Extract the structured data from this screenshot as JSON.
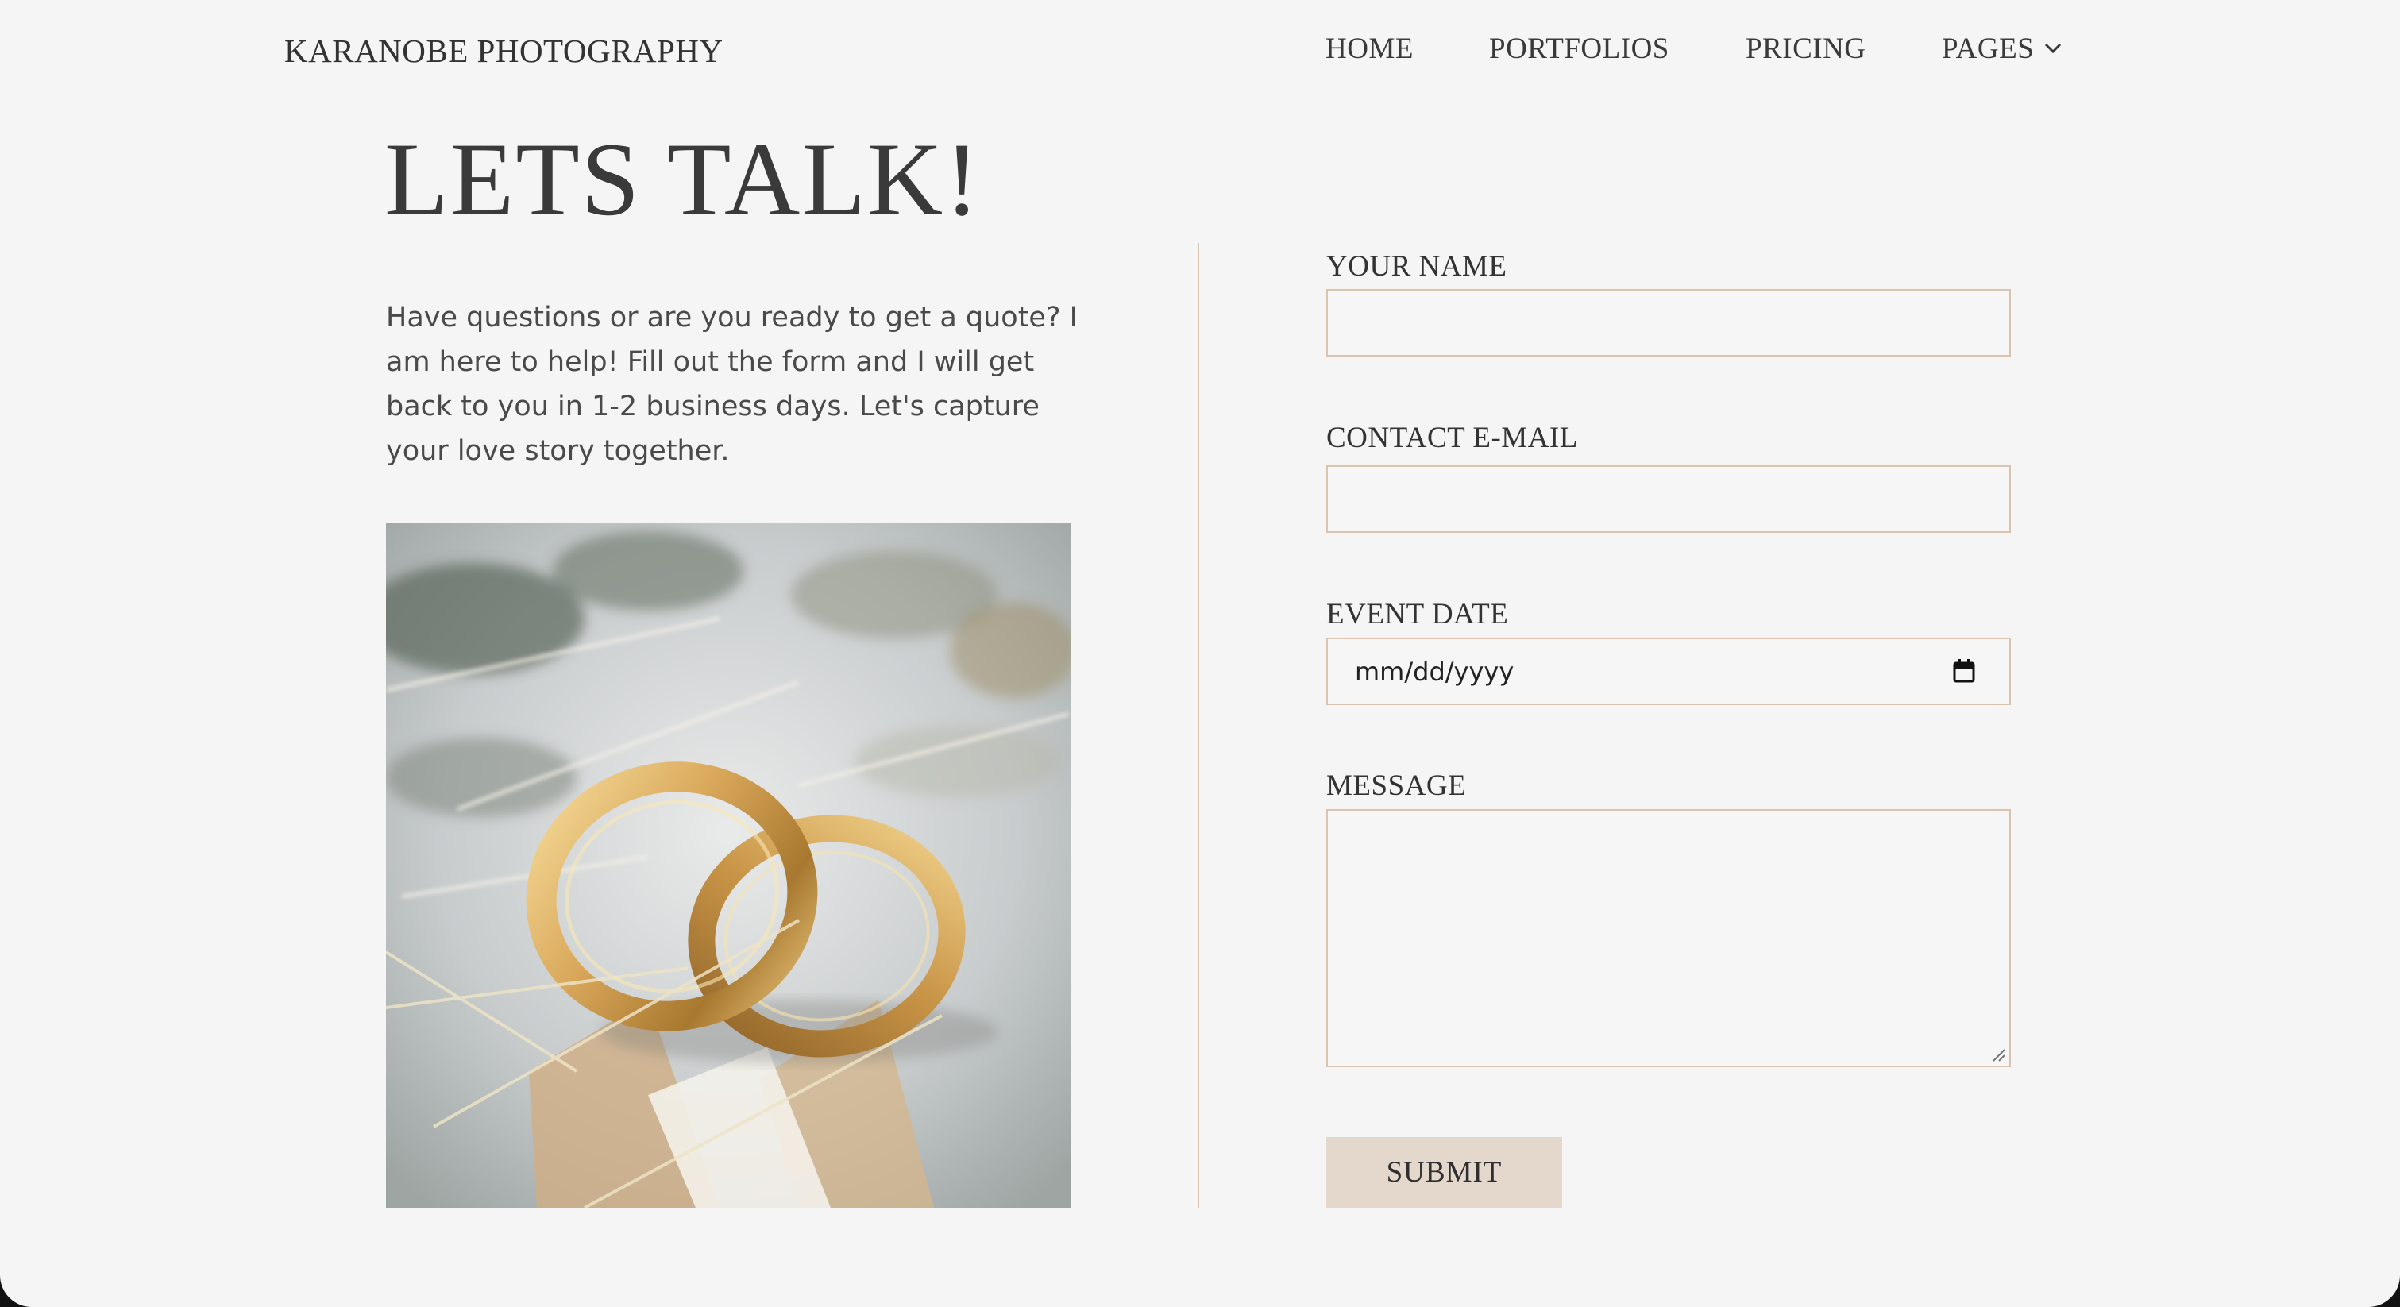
{
  "header": {
    "brand": "KARANOBE PHOTOGRAPHY",
    "nav": [
      "HOME",
      "PORTFOLIOS",
      "PRICING",
      "PAGES"
    ]
  },
  "hero": {
    "title": "LETS TALK!",
    "intro": "Have questions or are you ready to get a quote? I am here to help! Fill out the form and I will get back to you in 1-2 business days. Let's capture your love story together."
  },
  "form": {
    "name_label": "YOUR NAME",
    "name_value": "",
    "email_label": "CONTACT E-MAIL",
    "email_value": "",
    "date_label": "EVENT DATE",
    "date_placeholder": "mm/dd/yyyy",
    "message_label": "MESSAGE",
    "message_value": "",
    "submit_label": "SUBMIT"
  },
  "icons": {
    "nav_dropdown": "chevron-down-icon",
    "date_picker": "calendar-icon",
    "textarea_resize": "resize-handle-icon"
  },
  "colors": {
    "background": "#f5f5f5",
    "accent_border": "#d9c3b1",
    "button_bg": "#e4d7cc",
    "text": "#333333"
  }
}
